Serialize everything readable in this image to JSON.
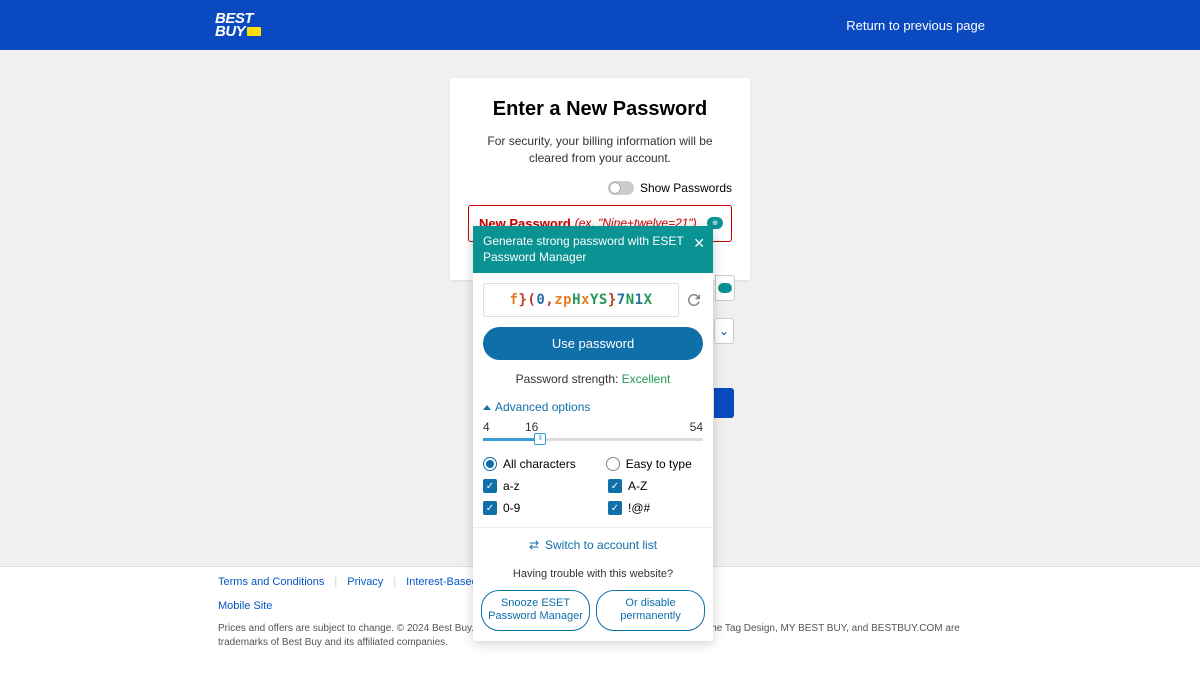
{
  "header": {
    "logo_line1": "BEST",
    "logo_line2": "BUY",
    "return_link": "Return to previous page"
  },
  "card": {
    "title": "Enter a New Password",
    "subtitle": "For security, your billing information will be cleared from your account.",
    "show_passwords_label": "Show Passwords",
    "pw_label": "New Password",
    "pw_placeholder": "(ex. \"Nine+twelve=21\")",
    "eset_badge": "⊕"
  },
  "eset": {
    "header": "Generate strong password with ESET Password Manager",
    "generated_chars": [
      {
        "c": "f",
        "cls": "gc-orange"
      },
      {
        "c": "}",
        "cls": "gc-red"
      },
      {
        "c": "(",
        "cls": "gc-red"
      },
      {
        "c": "0",
        "cls": "gc-blue"
      },
      {
        "c": ",",
        "cls": "gc-red"
      },
      {
        "c": "z",
        "cls": "gc-orange"
      },
      {
        "c": "p",
        "cls": "gc-orange"
      },
      {
        "c": "H",
        "cls": "gc-green"
      },
      {
        "c": "x",
        "cls": "gc-orange"
      },
      {
        "c": "Y",
        "cls": "gc-green"
      },
      {
        "c": "S",
        "cls": "gc-green"
      },
      {
        "c": "}",
        "cls": "gc-red"
      },
      {
        "c": "7",
        "cls": "gc-blue"
      },
      {
        "c": "N",
        "cls": "gc-green"
      },
      {
        "c": "1",
        "cls": "gc-blue"
      },
      {
        "c": "X",
        "cls": "gc-green"
      }
    ],
    "use_button": "Use password",
    "strength_label": "Password strength: ",
    "strength_value": "Excellent",
    "advanced_label": "Advanced options",
    "slider_min": "4",
    "slider_current": "16",
    "slider_max": "54",
    "radio_all": "All characters",
    "radio_easy": "Easy to type",
    "check_az": "a-z",
    "check_AZ": "A-Z",
    "check_09": "0-9",
    "check_sym": "!@#",
    "switch_label": "Switch to account list",
    "trouble": "Having trouble with this website?",
    "snooze_btn": "Snooze ESET Password Manager",
    "disable_btn": "Or disable permanently"
  },
  "footer": {
    "links": [
      "Terms and Conditions",
      "Privacy",
      "Interest-Based Ads"
    ],
    "mobile": "Mobile Site",
    "copyright": "Prices and offers are subject to change. © 2024 Best Buy. All rights reserved. BEST BUY, the BEST BUY logo, the Tag Design, MY BEST BUY, and BESTBUY.COM are trademarks of Best Buy and its affiliated companies."
  }
}
